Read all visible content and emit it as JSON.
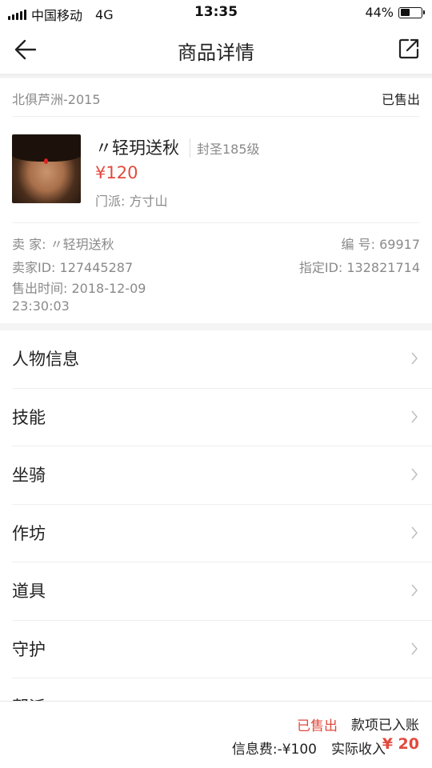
{
  "status_bar": {
    "carrier": "中国移动",
    "network": "4G",
    "time": "13:35",
    "battery": "44%",
    "battery_level": 0.44
  },
  "nav": {
    "title": "商品详情",
    "back_icon": "back-arrow-icon",
    "share_icon": "share-icon"
  },
  "listing": {
    "server": "北俱芦洲-2015",
    "status": "已售出",
    "role_name": "〃轻玥送秋",
    "level": "封圣185级",
    "price": "¥120",
    "sect": "门派: 方寸山",
    "seller": "卖 家: 〃轻玥送秋",
    "serial": "编 号: 69917",
    "seller_id": "卖家ID: 127445287",
    "assigned_id": "指定ID: 132821714",
    "sale_time": "售出时间: 2018-12-09 23:30:03"
  },
  "menu": {
    "items": [
      {
        "label": "人物信息"
      },
      {
        "label": "技能"
      },
      {
        "label": "坐骑"
      },
      {
        "label": "作坊"
      },
      {
        "label": "道具"
      },
      {
        "label": "守护"
      },
      {
        "label": "帮派"
      }
    ]
  },
  "bottom": {
    "sold": "已售出",
    "received": "款项已入账",
    "fee": "信息费:-¥100",
    "income_label": "实际收入",
    "income_value": "¥ 20"
  },
  "colors": {
    "accent_red": "#e24a3d",
    "muted_text": "#8a8a8a"
  }
}
